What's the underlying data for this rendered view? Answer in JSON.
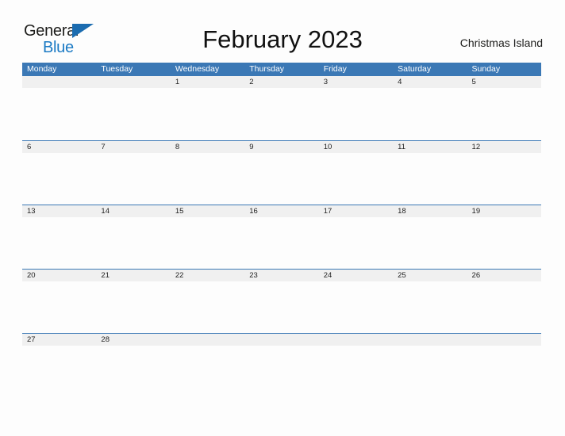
{
  "brand": {
    "name_part1": "General",
    "name_part2": "Blue",
    "color_dark": "#1d1d1b",
    "color_blue": "#1b7ac4"
  },
  "header": {
    "title": "February 2023",
    "location": "Christmas Island"
  },
  "colors": {
    "header_blue": "#3b78b5",
    "row_band_gray": "#f0f0f0",
    "page_background": "#fdfdfd",
    "text": "#222222"
  },
  "calendar": {
    "month": "February",
    "year": "2023",
    "weekdays": [
      "Monday",
      "Tuesday",
      "Wednesday",
      "Thursday",
      "Friday",
      "Saturday",
      "Sunday"
    ],
    "weeks": [
      [
        "",
        "",
        "1",
        "2",
        "3",
        "4",
        "5"
      ],
      [
        "6",
        "7",
        "8",
        "9",
        "10",
        "11",
        "12"
      ],
      [
        "13",
        "14",
        "15",
        "16",
        "17",
        "18",
        "19"
      ],
      [
        "20",
        "21",
        "22",
        "23",
        "24",
        "25",
        "26"
      ],
      [
        "27",
        "28",
        "",
        "",
        "",
        "",
        ""
      ]
    ]
  }
}
